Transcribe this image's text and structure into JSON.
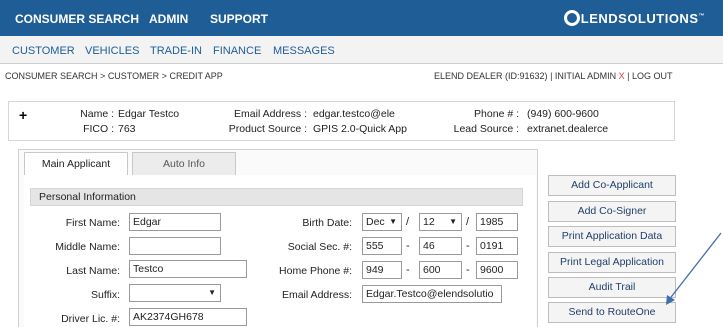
{
  "topnav": {
    "items": [
      "CONSUMER SEARCH",
      "ADMIN",
      "SUPPORT"
    ],
    "logo": "LENDSOLUTIONS",
    "logo_mark": "™"
  },
  "subnav": {
    "items": [
      "CUSTOMER",
      "VEHICLES",
      "TRADE-IN",
      "FINANCE",
      "MESSAGES"
    ]
  },
  "breadcrumb": {
    "items": [
      "CONSUMER SEARCH",
      ">",
      "CUSTOMER",
      ">",
      "CREDIT APP"
    ]
  },
  "userinfo": {
    "dealer": "ELEND DEALER (ID:91632)",
    "sep1": "|",
    "user": "INITIAL ADMIN",
    "close": "X",
    "sep2": "|",
    "logout": "LOG OUT"
  },
  "summary": {
    "expand": "+",
    "name_label": "Name :",
    "name": "Edgar Testco",
    "fico_label": "FICO :",
    "fico": "763",
    "email_label": "Email Address :",
    "email": "edgar.testco@ele",
    "product_label": "Product Source :",
    "product": "GPIS 2.0-Quick App",
    "phone_label": "Phone # :",
    "phone": "(949) 600-9600",
    "lead_label": "Lead Source :",
    "lead": "extranet.dealerce"
  },
  "tabs": [
    "Main Applicant",
    "Auto Info"
  ],
  "section": "Personal Information",
  "form": {
    "first_name_label": "First Name:",
    "first_name": "Edgar",
    "middle_name_label": "Middle Name:",
    "middle_name": "",
    "last_name_label": "Last Name:",
    "last_name": "Testco",
    "suffix_label": "Suffix:",
    "suffix": "",
    "license_label": "Driver Lic. #:",
    "license": "AK2374GH678",
    "birth_label": "Birth Date:",
    "birth_month": "Dec",
    "birth_day": "12",
    "birth_year": "1985",
    "slash": "/",
    "ssn_label": "Social Sec. #:",
    "ssn1": "555",
    "ssn2": "46",
    "ssn3": "0191",
    "home_phone_label": "Home Phone #:",
    "phone1": "949",
    "phone2": "600",
    "phone3": "9600",
    "dash": "-",
    "email_label": "Email Address:",
    "email": "Edgar.Testco@elendsolutio"
  },
  "actions": [
    "Add Co-Applicant",
    "Add Co-Signer",
    "Print Application Data",
    "Print Legal Application",
    "Audit Trail",
    "Send to RouteOne"
  ],
  "colors": {
    "topbar": "#1f5d97",
    "link": "#1f5d97",
    "arrow": "#3f6fb0"
  }
}
